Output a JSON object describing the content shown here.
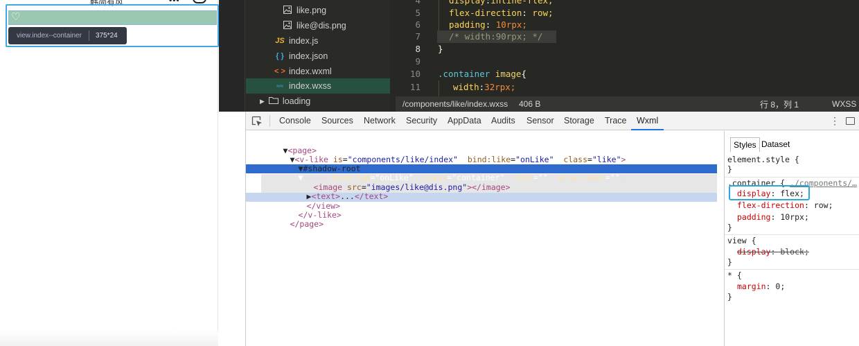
{
  "simulator": {
    "title": "韩简有风",
    "dots": "•••",
    "inspect_tooltip": {
      "selector": "view.index--container",
      "size": "375*24"
    }
  },
  "file_tree": {
    "items": [
      {
        "label": "like.png",
        "icon": "image-icon"
      },
      {
        "label": "like@dis.png",
        "icon": "image-icon"
      },
      {
        "label": "index.js",
        "icon": "js-icon",
        "icon_text": "JS"
      },
      {
        "label": "index.json",
        "icon": "json-icon",
        "icon_text": "{ }"
      },
      {
        "label": "index.wxml",
        "icon": "wxml-icon",
        "icon_text": "< >"
      },
      {
        "label": "index.wxss",
        "icon": "wxss-icon",
        "icon_text": "≈≈"
      },
      {
        "label": "loading",
        "icon": "folder-icon"
      }
    ]
  },
  "editor": {
    "lines": [
      {
        "num": "4",
        "prop": "display",
        "value": "inline-flex;"
      },
      {
        "num": "5",
        "prop": "flex-direction",
        "value": "row;"
      },
      {
        "num": "6",
        "prop": "padding",
        "value": "10rpx;"
      },
      {
        "num": "7",
        "comment": "/* width:90rpx; */"
      },
      {
        "num": "8",
        "text": "}"
      },
      {
        "num": "9",
        "text": ""
      },
      {
        "num": "10",
        "selector": ".container",
        "tag": "image",
        "brace": "{"
      },
      {
        "num": "11",
        "prop": "width",
        "value": "32rpx;"
      }
    ]
  },
  "status_bar": {
    "path": "/components/like/index.wxss",
    "size": "406 B",
    "position": "行 8，列 1",
    "language": "WXSS"
  },
  "devtools": {
    "tabs": [
      "Console",
      "Sources",
      "Network",
      "Security",
      "AppData",
      "Audits",
      "Sensor",
      "Storage",
      "Trace",
      "Wxml"
    ],
    "active_tab": "Wxml",
    "dom": {
      "page_open": "<page>",
      "v_like": {
        "tag": "v-like",
        "is": "components/like/index",
        "bind_like": "onLike",
        "class": "like"
      },
      "shadow_root": "#shadow-root",
      "view": {
        "tag": "view",
        "bind_tap": "onLike",
        "class": "container",
        "role": "",
        "aria_label": ""
      },
      "image": {
        "tag": "image",
        "src": "images/like@dis.png"
      },
      "text_node": {
        "tag": "text",
        "ellipsis": "..."
      },
      "view_close": "</view>",
      "v_like_close": "</v-like>",
      "page_close": "</page>"
    },
    "styles": {
      "tabs": [
        "Styles",
        "Dataset"
      ],
      "active_tab": "Styles",
      "rules": {
        "element_style": "element.style {",
        "container_selector": ".container {",
        "container_source": "./components/…",
        "container_props": [
          {
            "name": "display",
            "value": "flex;"
          },
          {
            "name": "flex-direction",
            "value": "row;"
          },
          {
            "name": "padding",
            "value": "10rpx;"
          }
        ],
        "view_selector": "view {",
        "view_prop": {
          "name": "display",
          "value": "block;"
        },
        "star_selector": "* {",
        "star_prop": {
          "name": "margin",
          "value": "0;"
        }
      }
    }
  },
  "colors": {
    "accent": "#3fa9e8",
    "editor_bg": "#272823",
    "selected_file": "#26513f",
    "dom_selected": "#2f6bcc"
  }
}
